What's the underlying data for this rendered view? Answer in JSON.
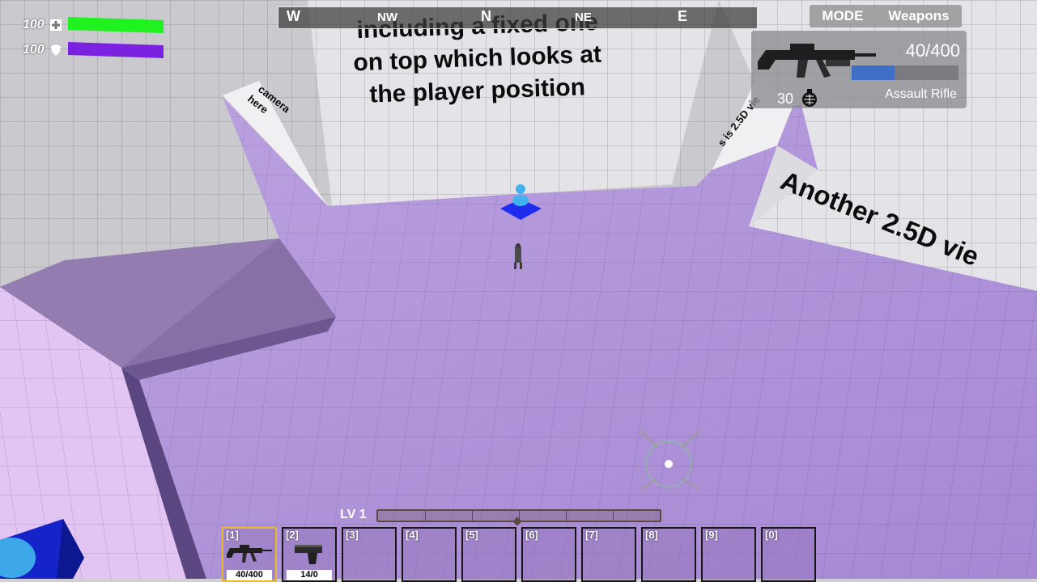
{
  "player": {
    "health": "100",
    "armor": "100",
    "health_color": "#1ff21f",
    "armor_color": "#7a22e0",
    "health_fill": 1.0,
    "armor_fill": 1.0
  },
  "compass": {
    "directions": [
      "W",
      "NW",
      "N",
      "NE",
      "E"
    ]
  },
  "mode_menu": {
    "mode_label": "MODE",
    "weapons_label": "Weapons"
  },
  "weapon": {
    "ammo": "40/400",
    "name": "Assault Rifle",
    "grenades": "30",
    "ammo_fill": 0.4,
    "icon": "assault-rifle-icon",
    "grenade_icon": "grenade-icon"
  },
  "world_text": {
    "top_line1": "including a fixed one",
    "top_line2": "on top which looks at",
    "top_line3": "the player position",
    "right_sign": "Another 2.5D vie",
    "left_wall_line1": "camera",
    "left_wall_line2": "here",
    "right_wall": "s is 2.5D vie"
  },
  "level": {
    "label": "LV 1",
    "progress": 0.5
  },
  "hotbar": {
    "selected": 0,
    "slots": [
      {
        "key": "[1]",
        "ammo": "40/400",
        "icon": "assault-rifle-icon"
      },
      {
        "key": "[2]",
        "ammo": "14/0",
        "icon": "pistol-icon"
      },
      {
        "key": "[3]"
      },
      {
        "key": "[4]"
      },
      {
        "key": "[5]"
      },
      {
        "key": "[6]"
      },
      {
        "key": "[7]"
      },
      {
        "key": "[8]"
      },
      {
        "key": "[9]"
      },
      {
        "key": "[0]"
      }
    ]
  },
  "colors": {
    "floor": "#b193dc",
    "wall": "#e6e6ea",
    "grid": "#9a9aa2",
    "accent": "#1d2fd6"
  }
}
